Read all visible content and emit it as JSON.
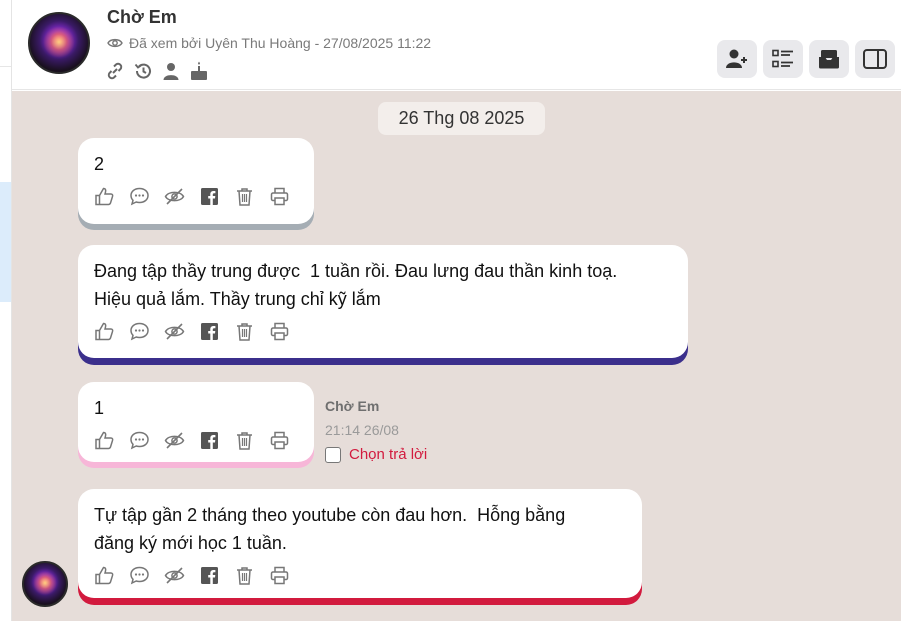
{
  "header": {
    "title": "Chờ Em",
    "seen_text": "Đã xem bởi Uyên Thu Hoàng - 27/08/2025 11:22",
    "icons": [
      "link-icon",
      "history-icon",
      "person-icon",
      "birthday-cake-icon"
    ],
    "toolbar": [
      "add-user-icon",
      "checklist-icon",
      "inbox-icon",
      "side-panel-icon"
    ]
  },
  "chat": {
    "date_label": "26 Thg 08 2025",
    "messages": [
      {
        "text": "2",
        "accent": "#a5adb4"
      },
      {
        "text": "Đang tập thầy trung được  1 tuần rồi. Đau lưng đau thần kinh toạ.\nHiệu quả lắm. Thầy trung chỉ kỹ lắm",
        "accent": "#3b2f8c"
      },
      {
        "text": "1",
        "accent": "#f7b6d8"
      },
      {
        "text": "Tự tập gần 2 tháng theo youtube còn đau hơn.  Hỗng bằng\nđăng ký mới học 1 tuần.",
        "accent": "#d21a3e"
      }
    ],
    "action_icons": [
      "like-icon",
      "comment-icon",
      "hide-icon",
      "facebook-icon",
      "trash-icon",
      "print-icon"
    ],
    "meta": {
      "author": "Chờ Em",
      "time": "21:14 26/08",
      "reply_label": "Chọn trả lời"
    }
  },
  "colors": {
    "chat_background": "#e6ddd9",
    "reply_red": "#d21a3e"
  }
}
